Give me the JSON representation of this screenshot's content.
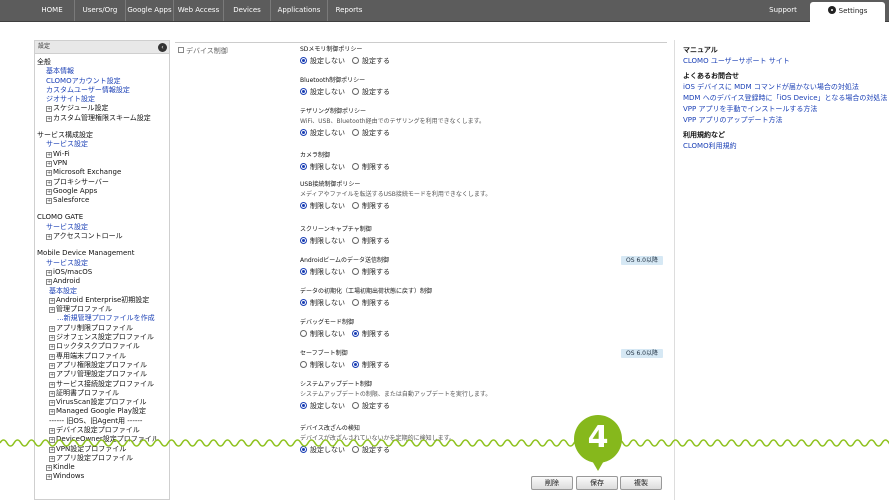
{
  "topnav": {
    "items": [
      "HOME",
      "Users/Org",
      "Google Apps",
      "Web Access",
      "Devices",
      "Applications",
      "Reports"
    ],
    "support": "Support",
    "settings": "Settings"
  },
  "sidebar": {
    "header": "設定",
    "rows": [
      {
        "text": "全般",
        "kind": "sec",
        "indent": 0
      },
      {
        "text": "基本情報",
        "kind": "link",
        "indent": 1
      },
      {
        "text": "CLOMOアカウント設定",
        "kind": "link",
        "indent": 1
      },
      {
        "text": "カスタムユーザー情報設定",
        "kind": "link",
        "indent": 1
      },
      {
        "text": "ジオサイト設定",
        "kind": "link",
        "indent": 1
      },
      {
        "text": "スケジュール設定",
        "kind": "sec",
        "indent": 1,
        "exp": true
      },
      {
        "text": "カスタム管理権限スキーム設定",
        "kind": "sec",
        "indent": 1,
        "exp": true
      },
      {
        "text": "",
        "kind": "gap"
      },
      {
        "text": "サービス構成設定",
        "kind": "sec",
        "indent": 0
      },
      {
        "text": "サービス設定",
        "kind": "link",
        "indent": 1
      },
      {
        "text": "Wi-Fi",
        "kind": "sec",
        "indent": 1,
        "exp": true
      },
      {
        "text": "VPN",
        "kind": "sec",
        "indent": 1,
        "exp": true
      },
      {
        "text": "Microsoft Exchange",
        "kind": "sec",
        "indent": 1,
        "exp": true
      },
      {
        "text": "プロキシサーバー",
        "kind": "sec",
        "indent": 1,
        "exp": true
      },
      {
        "text": "Google Apps",
        "kind": "sec",
        "indent": 1,
        "exp": true
      },
      {
        "text": "Salesforce",
        "kind": "sec",
        "indent": 1,
        "exp": true
      },
      {
        "text": "",
        "kind": "gap"
      },
      {
        "text": "CLOMO GATE",
        "kind": "sec",
        "indent": 0
      },
      {
        "text": "サービス設定",
        "kind": "link",
        "indent": 1
      },
      {
        "text": "アクセスコントロール",
        "kind": "sec",
        "indent": 1,
        "exp": true
      },
      {
        "text": "",
        "kind": "gap"
      },
      {
        "text": "Mobile Device Management",
        "kind": "sec",
        "indent": 0
      },
      {
        "text": "サービス設定",
        "kind": "link",
        "indent": 1
      },
      {
        "text": "iOS/macOS",
        "kind": "sec",
        "indent": 1,
        "exp": true
      },
      {
        "text": "Android",
        "kind": "sec",
        "indent": 1,
        "exp": true
      },
      {
        "text": "基本設定",
        "kind": "link",
        "indent": 2
      },
      {
        "text": "Android Enterprise初期設定",
        "kind": "sec",
        "indent": 2,
        "exp": true
      },
      {
        "text": "管理プロファイル",
        "kind": "sec",
        "indent": 2,
        "exp": true
      },
      {
        "text": "...新規管理プロファイルを作成",
        "kind": "link",
        "indent": 3
      },
      {
        "text": "アプリ制限プロファイル",
        "kind": "sec",
        "indent": 2,
        "exp": true
      },
      {
        "text": "ジオフェンス設定プロファイル",
        "kind": "sec",
        "indent": 2,
        "exp": true
      },
      {
        "text": "ロックタスクプロファイル",
        "kind": "sec",
        "indent": 2,
        "exp": true
      },
      {
        "text": "専用端末プロファイル",
        "kind": "sec",
        "indent": 2,
        "exp": true
      },
      {
        "text": "アプリ権限設定プロファイル",
        "kind": "sec",
        "indent": 2,
        "exp": true
      },
      {
        "text": "アプリ管理設定プロファイル",
        "kind": "sec",
        "indent": 2,
        "exp": true
      },
      {
        "text": "サービス接続設定プロファイル",
        "kind": "sec",
        "indent": 2,
        "exp": true
      },
      {
        "text": "証明書プロファイル",
        "kind": "sec",
        "indent": 2,
        "exp": true
      },
      {
        "text": "VirusScan設定プロファイル",
        "kind": "sec",
        "indent": 2,
        "exp": true
      },
      {
        "text": "Managed Google Play設定",
        "kind": "sec",
        "indent": 2,
        "exp": true
      },
      {
        "text": "------ 旧OS、旧Agent用 ------",
        "kind": "sec",
        "indent": 2
      },
      {
        "text": "デバイス設定プロファイル",
        "kind": "sec",
        "indent": 2,
        "exp": true
      },
      {
        "text": "DeviceOwner設定プロファイル",
        "kind": "sec",
        "indent": 2,
        "exp": true
      },
      {
        "text": "VPN設定プロファイル",
        "kind": "sec",
        "indent": 2,
        "exp": true
      },
      {
        "text": "アプリ設定プロファイル",
        "kind": "sec",
        "indent": 2,
        "exp": true
      },
      {
        "text": "Kindle",
        "kind": "sec",
        "indent": 1,
        "exp": true
      },
      {
        "text": "Windows",
        "kind": "sec",
        "indent": 1,
        "exp": true
      }
    ]
  },
  "main": {
    "category": "デバイス制御",
    "policies": [
      {
        "title": "SDメモリ制御ポリシー",
        "desc": "",
        "badge": "",
        "options": [
          "設定しない",
          "設定する"
        ],
        "selected": 0
      },
      {
        "title": "Bluetooth制御ポリシー",
        "desc": "",
        "badge": "",
        "options": [
          "設定しない",
          "設定する"
        ],
        "selected": 0
      },
      {
        "title": "テザリング制御ポリシー",
        "desc": "WiFi、USB、Bluetooth経由でのテザリングを利用できなくします。",
        "badge": "",
        "options": [
          "設定しない",
          "設定する"
        ],
        "selected": 0
      },
      {
        "title": "カメラ制御",
        "desc": "",
        "badge": "",
        "options": [
          "制限しない",
          "制限する"
        ],
        "selected": 0
      },
      {
        "title": "USB接続制御ポリシー",
        "desc": "メディアやファイルを転送するUSB接続モードを利用できなくします。",
        "badge": "",
        "options": [
          "制限しない",
          "制限する"
        ],
        "selected": 0
      },
      {
        "title": "スクリーンキャプチャ制御",
        "desc": "",
        "badge": "",
        "options": [
          "制限しない",
          "制限する"
        ],
        "selected": 0
      },
      {
        "title": "Androidビームのデータ送信制御",
        "desc": "",
        "badge": "OS 6.0以降",
        "options": [
          "制限しない",
          "制限する"
        ],
        "selected": 0
      },
      {
        "title": "データの初期化（工場初期出荷状態に戻す）制御",
        "desc": "",
        "badge": "",
        "options": [
          "制限しない",
          "制限する"
        ],
        "selected": 0
      },
      {
        "title": "デバッグモード制御",
        "desc": "",
        "badge": "",
        "options": [
          "制限しない",
          "制限する"
        ],
        "selected": 1
      },
      {
        "title": "セーフブート制御",
        "desc": "",
        "badge": "OS 6.0以降",
        "options": [
          "制限しない",
          "制限する"
        ],
        "selected": 1
      },
      {
        "title": "システムアップデート制御",
        "desc": "システムアップデートの制限、または自動アップデートを実行します。",
        "badge": "",
        "options": [
          "設定しない",
          "設定する"
        ],
        "selected": 0
      },
      {
        "title": "デバイス改ざんの検知",
        "desc": "デバイスが改ざんされていないかを定期的に検知します。",
        "badge": "",
        "options": [
          "設定しない",
          "設定する"
        ],
        "selected": 0
      }
    ],
    "buttons": {
      "delete": "削除",
      "save": "保存",
      "copy": "複製"
    }
  },
  "rightpanel": {
    "manual_title": "マニュアル",
    "manual_links": [
      "CLOMO ユーザーサポート サイト"
    ],
    "faq_title": "よくあるお問合せ",
    "faq_links": [
      "iOS デバイスに MDM コマンドが届かない場合の対処法",
      "MDM へのデバイス登録時に「iOS Device」となる場合の対処法",
      "VPP アプリを手動でインストールする方法",
      "VPP アプリのアップデート方法"
    ],
    "terms_title": "利用規約など",
    "terms_links": [
      "CLOMO利用規約"
    ]
  },
  "callout": {
    "step": "4"
  },
  "colors": {
    "topbar": "#5c5c5c",
    "link": "#1a3fb5",
    "callout": "#86b81c",
    "badge": "#d6e8f4",
    "wave": "#8fc21f"
  }
}
